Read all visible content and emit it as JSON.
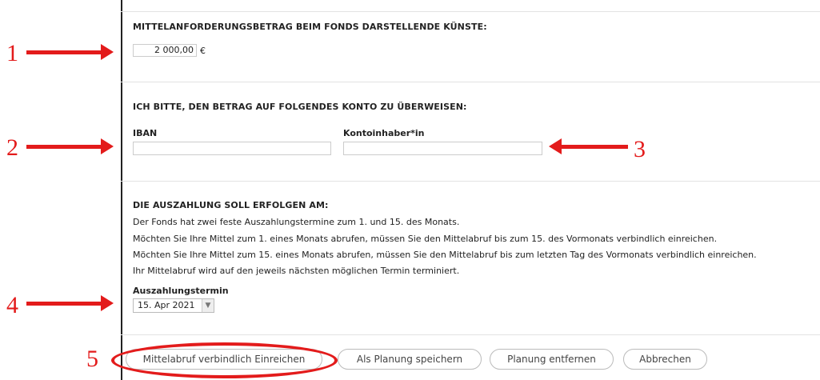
{
  "section1": {
    "heading": "MITTELANFORDERUNGSBETRAG BEIM FONDS DARSTELLENDE KÜNSTE:",
    "amount_value": "2 000,00",
    "currency": "€"
  },
  "section2": {
    "heading": "ICH BITTE, DEN BETRAG AUF FOLGENDES KONTO ZU ÜBERWEISEN:",
    "iban_label": "IBAN",
    "iban_value": "",
    "holder_label": "Kontoinhaber*in",
    "holder_value": ""
  },
  "section3": {
    "heading": "DIE AUSZAHLUNG SOLL ERFOLGEN AM:",
    "lines": [
      "Der Fonds hat zwei feste Auszahlungstermine zum 1. und 15. des Monats.",
      "Möchten Sie Ihre Mittel zum 1. eines Monats abrufen, müssen Sie den Mittelabruf bis zum 15. des Vormonats verbindlich einreichen.",
      "Möchten Sie Ihre Mittel zum 15. eines Monats abrufen, müssen Sie den Mittelabruf bis zum letzten Tag des Vormonats verbindlich einreichen.",
      "Ihr Mittelabruf wird auf den jeweils nächsten möglichen Termin terminiert."
    ],
    "date_label": "Auszahlungstermin",
    "date_value": "15. Apr 2021"
  },
  "buttons": {
    "submit": "Mittelabruf verbindlich Einreichen",
    "save_plan": "Als Planung speichern",
    "remove_plan": "Planung entfernen",
    "cancel": "Abbrechen"
  },
  "annotations": {
    "m1": "1",
    "m2": "2",
    "m3": "3",
    "m4": "4",
    "m5": "5",
    "color": "#e31b1b"
  }
}
